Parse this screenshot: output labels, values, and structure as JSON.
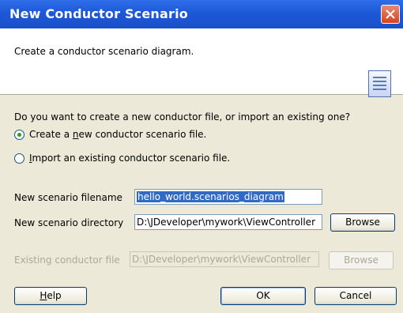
{
  "window": {
    "title": "New Conductor Scenario"
  },
  "header": {
    "description": "Create a conductor scenario diagram."
  },
  "question": "Do you want to create a new conductor file, or import an existing one?",
  "options": {
    "create": {
      "before": "Create a ",
      "mnemonic": "n",
      "after": "ew conductor scenario file.",
      "selected": true
    },
    "import": {
      "mnemonic": "I",
      "after": "mport an existing conductor scenario file.",
      "selected": false
    }
  },
  "fields": {
    "filename": {
      "label": "New scenario filename",
      "value": "hello_world.scenarios_diagram"
    },
    "directory": {
      "label": "New scenario directory",
      "value": "D:\\JDeveloper\\mywork\\ViewController",
      "button": "Browse"
    },
    "existing": {
      "label": "Existing conductor file",
      "value": "D:\\JDeveloper\\mywork\\ViewController",
      "button": "Browse",
      "enabled": false
    }
  },
  "buttons": {
    "help_mnemonic": "H",
    "help_rest": "elp",
    "ok": "OK",
    "cancel": "Cancel"
  },
  "colors": {
    "title_bar": "#1d58d8",
    "dialog_bg": "#ece9d8",
    "selection": "#316ac5"
  }
}
